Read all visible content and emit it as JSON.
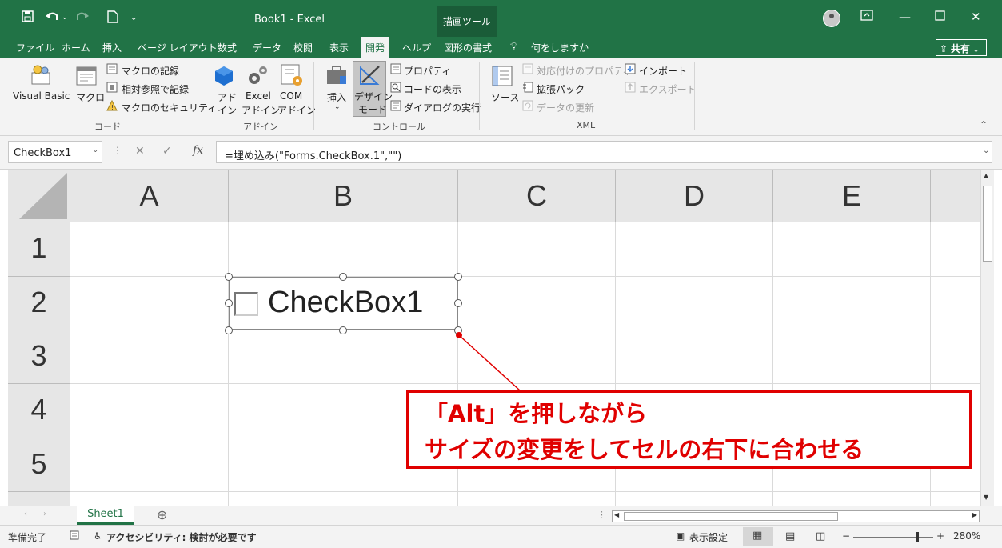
{
  "titlebar": {
    "title": "Book1  -  Excel",
    "drawing_tools": "描画ツール",
    "icons": [
      "save-icon",
      "undo-icon",
      "redo-icon",
      "new-file-icon",
      "customize-qat-icon",
      "account-icon",
      "ribbon-display-icon",
      "minimize-icon",
      "maximize-icon",
      "close-icon"
    ]
  },
  "tabs": [
    "ファイル",
    "ホーム",
    "挿入",
    "ページ レイアウト",
    "数式",
    "データ",
    "校閲",
    "表示",
    "開発",
    "ヘルプ",
    "図形の書式"
  ],
  "active_tab": "開発",
  "tell_me": "何をしますか",
  "share": "共有",
  "ribbon": {
    "code": {
      "visual_basic": "Visual Basic",
      "macro": "マクロ",
      "record_macro": "マクロの記録",
      "relative_ref": "相対参照で記録",
      "macro_security": "マクロのセキュリティ",
      "label": "コード"
    },
    "addins": {
      "addin_1": "アド",
      "addin_2": "イン",
      "excel_addin_1": "Excel",
      "excel_addin_2": "アドイン",
      "com_addin_1": "COM",
      "com_addin_2": "アドイン",
      "label": "アドイン"
    },
    "controls": {
      "insert": "挿入",
      "design_mode_1": "デザイン",
      "design_mode_2": "モード",
      "properties": "プロパティ",
      "view_code": "コードの表示",
      "run_dialog": "ダイアログの実行",
      "label": "コントロール"
    },
    "xml": {
      "source": "ソース",
      "map_properties": "対応付けのプロパティ",
      "expansion_packs": "拡張パック",
      "refresh_data": "データの更新",
      "import": "インポート",
      "export": "エクスポート",
      "label": "XML"
    }
  },
  "formula_bar": {
    "name_box": "CheckBox1",
    "fx": "fx",
    "formula": "=埋め込み(\"Forms.CheckBox.1\",\"\")"
  },
  "grid": {
    "columns": [
      "A",
      "B",
      "C",
      "D",
      "E"
    ],
    "rows": [
      "1",
      "2",
      "3",
      "4",
      "5"
    ]
  },
  "checkbox": {
    "label": "CheckBox1"
  },
  "annotation": {
    "line1": "「Alt」を押しながら",
    "line2": "サイズの変更をしてセルの右下に合わせる",
    "color": "#e00000"
  },
  "sheets": {
    "active": "Sheet1"
  },
  "status": {
    "ready": "準備完了",
    "accessibility": "アクセシビリティ: 検討が必要です",
    "display_settings": "表示設定",
    "zoom": "280%"
  },
  "colors": {
    "excel_green": "#217346"
  }
}
